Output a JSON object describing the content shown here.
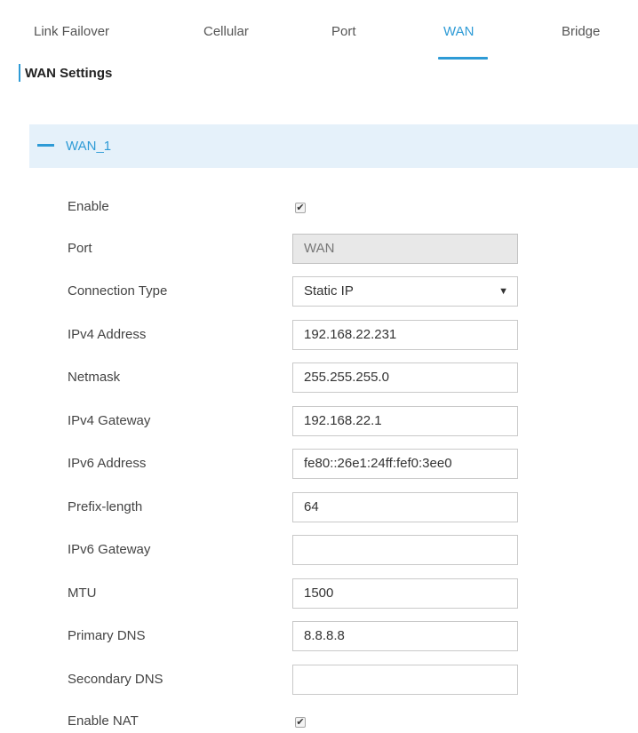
{
  "tabs": [
    {
      "label": "Link Failover"
    },
    {
      "label": "Cellular"
    },
    {
      "label": "Port"
    },
    {
      "label": "WAN",
      "active": true
    },
    {
      "label": "Bridge"
    }
  ],
  "section_title": "WAN Settings",
  "panel": {
    "title": "WAN_1",
    "collapse_icon": "minus-icon"
  },
  "form": {
    "enable": {
      "label": "Enable",
      "checked": true,
      "mark": "✔"
    },
    "port": {
      "label": "Port",
      "value": "WAN"
    },
    "connection_type": {
      "label": "Connection Type",
      "value": "Static IP",
      "arrow": "▼"
    },
    "ipv4_address": {
      "label": "IPv4 Address",
      "value": "192.168.22.231"
    },
    "netmask": {
      "label": "Netmask",
      "value": "255.255.255.0"
    },
    "ipv4_gateway": {
      "label": "IPv4 Gateway",
      "value": "192.168.22.1"
    },
    "ipv6_address": {
      "label": "IPv6 Address",
      "value": "fe80::26e1:24ff:fef0:3ee0"
    },
    "prefix_length": {
      "label": "Prefix-length",
      "value": "64"
    },
    "ipv6_gateway": {
      "label": "IPv6 Gateway",
      "value": ""
    },
    "mtu": {
      "label": "MTU",
      "value": "1500"
    },
    "primary_dns": {
      "label": "Primary DNS",
      "value": "8.8.8.8"
    },
    "secondary_dns": {
      "label": "Secondary DNS",
      "value": ""
    },
    "enable_nat": {
      "label": "Enable NAT",
      "checked": true,
      "mark": "✔"
    }
  },
  "colors": {
    "accent": "#2e9bd6",
    "panel_header_bg": "#e5f1fa"
  }
}
